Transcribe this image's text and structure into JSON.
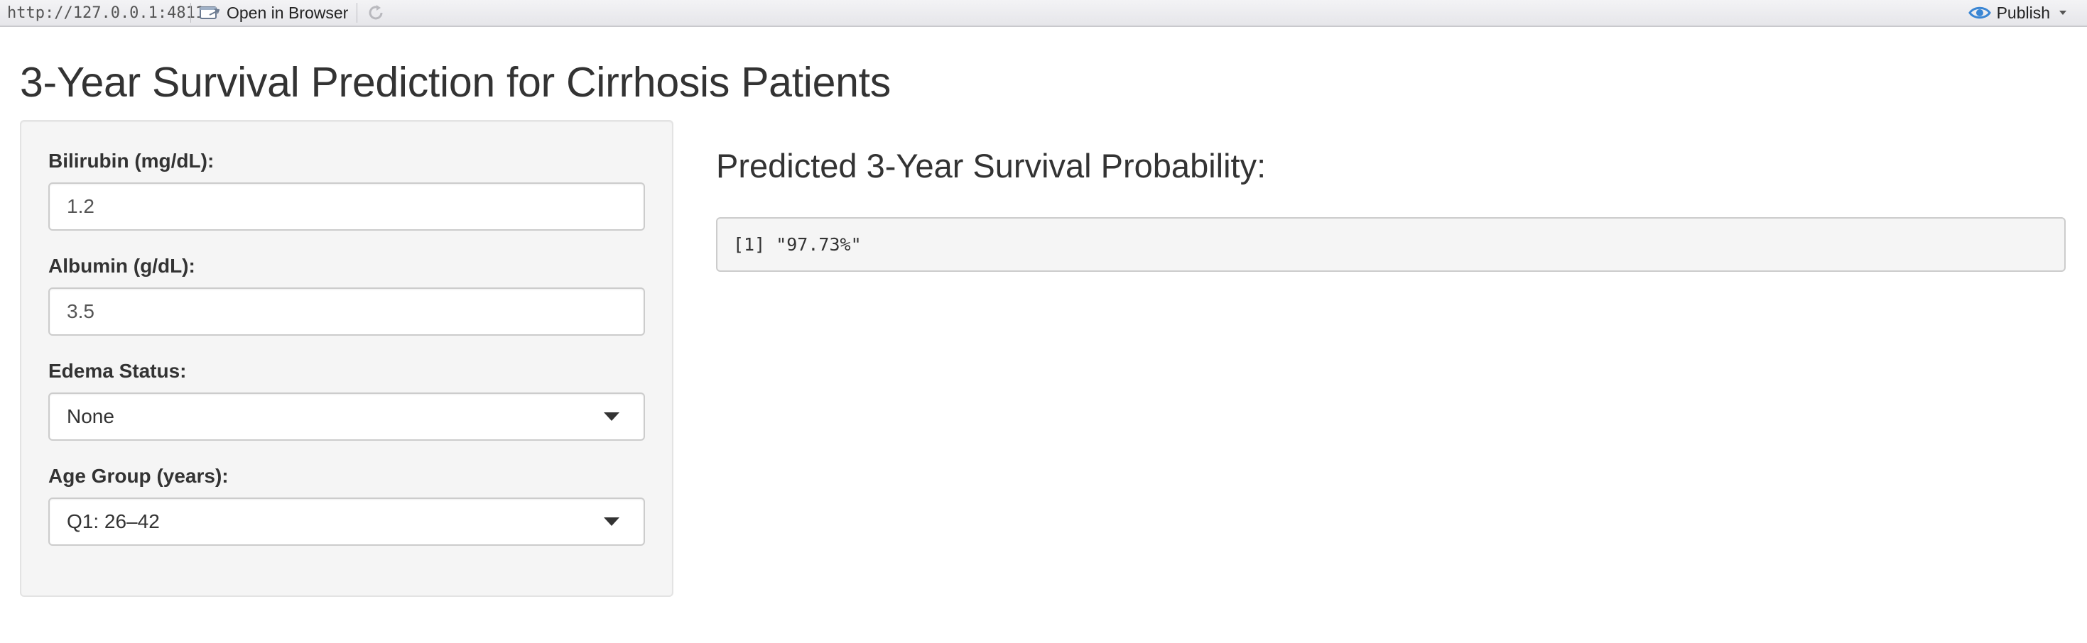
{
  "viewer": {
    "url": "http://127.0.0.1:4811",
    "open_in_browser_label": "Open in Browser",
    "publish_label": "Publish",
    "accent_color": "#3a86d4"
  },
  "app": {
    "title": "3-Year Survival Prediction for Cirrhosis Patients",
    "inputs": {
      "bilirubin": {
        "label": "Bilirubin (mg/dL):",
        "value": "1.2"
      },
      "albumin": {
        "label": "Albumin (g/dL):",
        "value": "3.5"
      },
      "edema": {
        "label": "Edema Status:",
        "selected": "None"
      },
      "age_group": {
        "label": "Age Group (years):",
        "selected": "Q1: 26–42"
      }
    },
    "output": {
      "heading": "Predicted 3-Year Survival Probability:",
      "text": "[1] \"97.73%\""
    }
  },
  "icons": {
    "open_in_browser": "browser-window-icon",
    "refresh": "refresh-icon",
    "publish": "publish-eye-icon",
    "publish_menu": "chevron-down-icon",
    "select_caret": "caret-down-icon"
  }
}
